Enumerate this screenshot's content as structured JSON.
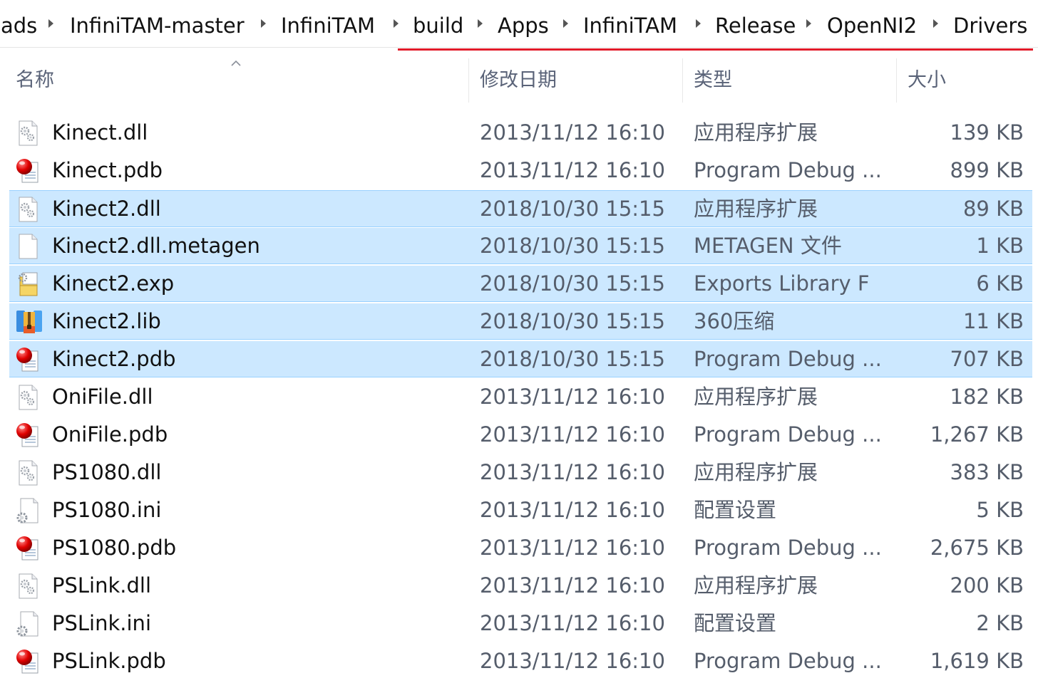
{
  "breadcrumb": {
    "items": [
      "ads",
      "InfiniTAM-master",
      "InfiniTAM",
      "build",
      "Apps",
      "InfiniTAM",
      "Release",
      "OpenNI2",
      "Drivers"
    ]
  },
  "columns": {
    "name": "名称",
    "date": "修改日期",
    "type": "类型",
    "size": "大小"
  },
  "colors": {
    "selection": "#cce8ff",
    "underline": "#e21b2a"
  },
  "files": [
    {
      "name": "Kinect.dll",
      "date": "2013/11/12 16:10",
      "type": "应用程序扩展",
      "size": "139 KB",
      "icon": "dll-icon",
      "selected": false
    },
    {
      "name": "Kinect.pdb",
      "date": "2013/11/12 16:10",
      "type": "Program Debug ...",
      "size": "899 KB",
      "icon": "pdb-icon",
      "selected": false
    },
    {
      "name": "Kinect2.dll",
      "date": "2018/10/30 15:15",
      "type": "应用程序扩展",
      "size": "89 KB",
      "icon": "dll-icon",
      "selected": true
    },
    {
      "name": "Kinect2.dll.metagen",
      "date": "2018/10/30 15:15",
      "type": "METAGEN 文件",
      "size": "1 KB",
      "icon": "blank-file-icon",
      "selected": true
    },
    {
      "name": "Kinect2.exp",
      "date": "2018/10/30 15:15",
      "type": "Exports Library F",
      "size": "6 KB",
      "icon": "exp-icon",
      "selected": true
    },
    {
      "name": "Kinect2.lib",
      "date": "2018/10/30 15:15",
      "type": "360压缩",
      "size": "11 KB",
      "icon": "archive-icon",
      "selected": true
    },
    {
      "name": "Kinect2.pdb",
      "date": "2018/10/30 15:15",
      "type": "Program Debug ...",
      "size": "707 KB",
      "icon": "pdb-icon",
      "selected": true
    },
    {
      "name": "OniFile.dll",
      "date": "2013/11/12 16:10",
      "type": "应用程序扩展",
      "size": "182 KB",
      "icon": "dll-icon",
      "selected": false
    },
    {
      "name": "OniFile.pdb",
      "date": "2013/11/12 16:10",
      "type": "Program Debug ...",
      "size": "1,267 KB",
      "icon": "pdb-icon",
      "selected": false
    },
    {
      "name": "PS1080.dll",
      "date": "2013/11/12 16:10",
      "type": "应用程序扩展",
      "size": "383 KB",
      "icon": "dll-icon",
      "selected": false
    },
    {
      "name": "PS1080.ini",
      "date": "2013/11/12 16:10",
      "type": "配置设置",
      "size": "5 KB",
      "icon": "ini-icon",
      "selected": false
    },
    {
      "name": "PS1080.pdb",
      "date": "2013/11/12 16:10",
      "type": "Program Debug ...",
      "size": "2,675 KB",
      "icon": "pdb-icon",
      "selected": false
    },
    {
      "name": "PSLink.dll",
      "date": "2013/11/12 16:10",
      "type": "应用程序扩展",
      "size": "200 KB",
      "icon": "dll-icon",
      "selected": false
    },
    {
      "name": "PSLink.ini",
      "date": "2013/11/12 16:10",
      "type": "配置设置",
      "size": "2 KB",
      "icon": "ini-icon",
      "selected": false
    },
    {
      "name": "PSLink.pdb",
      "date": "2013/11/12 16:10",
      "type": "Program Debug ...",
      "size": "1,619 KB",
      "icon": "pdb-icon",
      "selected": false
    }
  ]
}
